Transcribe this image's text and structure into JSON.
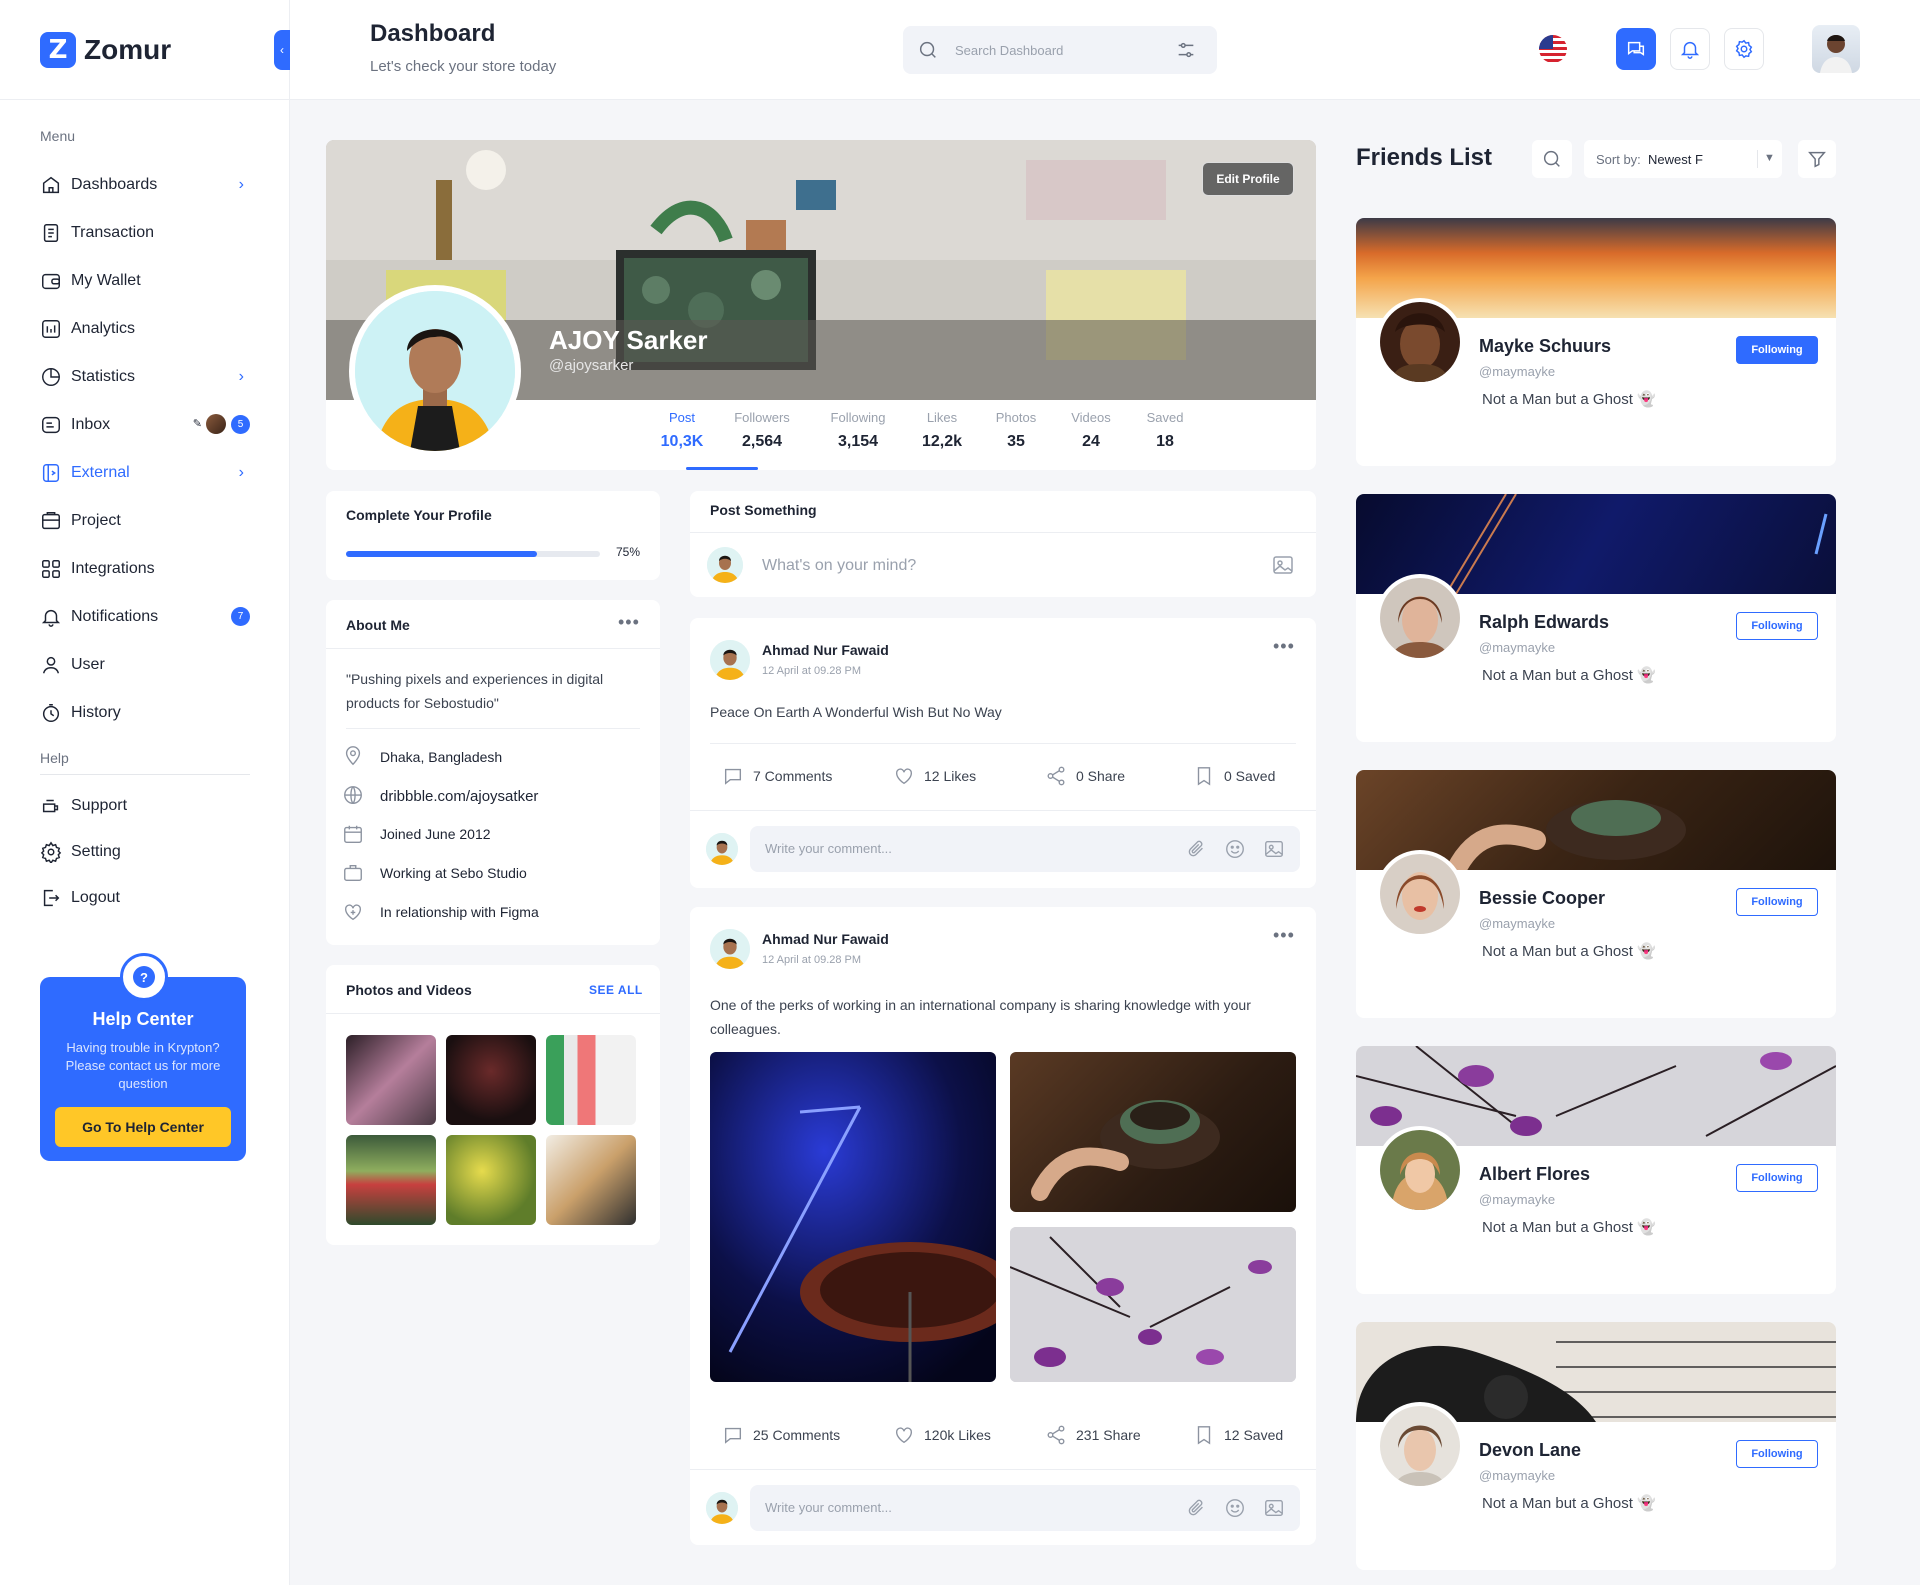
{
  "app": {
    "name": "Zomur"
  },
  "sidebar": {
    "menu_label": "Menu",
    "help_label": "Help",
    "items": [
      {
        "label": "Dashboards",
        "icon": "home-icon",
        "chevron": true
      },
      {
        "label": "Transaction",
        "icon": "receipt-icon"
      },
      {
        "label": "My Wallet",
        "icon": "wallet-icon"
      },
      {
        "label": "Analytics",
        "icon": "analytics-icon"
      },
      {
        "label": "Statistics",
        "icon": "pie-chart-icon",
        "chevron": true
      },
      {
        "label": "Inbox",
        "icon": "inbox-icon",
        "badge": "5"
      },
      {
        "label": "External",
        "icon": "external-icon",
        "chevron": true,
        "active": true
      },
      {
        "label": "Project",
        "icon": "project-icon"
      },
      {
        "label": "Integrations",
        "icon": "integrations-icon"
      },
      {
        "label": "Notifications",
        "icon": "bell-icon",
        "badge": "7"
      },
      {
        "label": "User",
        "icon": "user-icon"
      },
      {
        "label": "History",
        "icon": "history-icon"
      }
    ],
    "help_items": [
      {
        "label": "Support",
        "icon": "support-icon"
      },
      {
        "label": "Setting",
        "icon": "gear-icon"
      },
      {
        "label": "Logout",
        "icon": "logout-icon"
      }
    ],
    "help_card": {
      "title": "Help Center",
      "text": "Having trouble in Krypton? Please contact us for more question",
      "button": "Go To Help Center"
    }
  },
  "header": {
    "title": "Dashboard",
    "subtitle": "Let's check your store today",
    "search_placeholder": "Search Dashboard"
  },
  "profile": {
    "name": "AJOY Sarker",
    "handle": "@ajoysarker",
    "edit_label": "Edit Profile",
    "stats": [
      {
        "label": "Post",
        "value": "10,3K",
        "active": true
      },
      {
        "label": "Followers",
        "value": "2,564"
      },
      {
        "label": "Following",
        "value": "3,154"
      },
      {
        "label": "Likes",
        "value": "12,2k"
      },
      {
        "label": "Photos",
        "value": "35"
      },
      {
        "label": "Videos",
        "value": "24"
      },
      {
        "label": "Saved",
        "value": "18"
      }
    ]
  },
  "complete_profile": {
    "title": "Complete Your Profile",
    "percent_label": "75%",
    "progress": 0.75
  },
  "about": {
    "title": "About Me",
    "quote": "\"Pushing pixels and experiences in digital products for Sebostudio\"",
    "location": "Dhaka, Bangladesh",
    "website": "dribbble.com/ajoysatker",
    "joined": "Joined June 2012",
    "work": "Working at Sebo Studio",
    "relationship": "In relationship with Figma"
  },
  "media": {
    "title": "Photos and Videos",
    "see_all": "SEE ALL"
  },
  "composer": {
    "title": "Post Something",
    "placeholder": "What's on your mind?"
  },
  "posts": [
    {
      "author": "Ahmad Nur Fawaid",
      "time": "12 April at 09.28 PM",
      "text": "Peace On Earth A Wonderful Wish But No Way",
      "comments": "7 Comments",
      "likes": "12 Likes",
      "share": "0 Share",
      "saved": "0 Saved",
      "comment_placeholder": "Write your comment..."
    },
    {
      "author": "Ahmad Nur Fawaid",
      "time": "12 April at 09.28 PM",
      "text": "One of the perks of working in an international company is sharing knowledge with your colleagues.",
      "comments": "25 Comments",
      "likes": "120k Likes",
      "share": "231 Share",
      "saved": "12 Saved",
      "comment_placeholder": "Write your comment..."
    }
  ],
  "friends": {
    "title": "Friends List",
    "sort_label": "Sort by:",
    "sort_value": "Newest F",
    "list": [
      {
        "name": "Mayke Schuurs",
        "handle": "@maymayke",
        "bio": "Not a Man but a Ghost 👻",
        "follow": "Following",
        "solid": true
      },
      {
        "name": "Ralph Edwards",
        "handle": "@maymayke",
        "bio": "Not a Man but a Ghost 👻",
        "follow": "Following"
      },
      {
        "name": "Bessie Cooper",
        "handle": "@maymayke",
        "bio": "Not a Man but a Ghost 👻",
        "follow": "Following"
      },
      {
        "name": "Albert Flores",
        "handle": "@maymayke",
        "bio": "Not a Man but a Ghost 👻",
        "follow": "Following"
      },
      {
        "name": "Devon Lane",
        "handle": "@maymayke",
        "bio": "Not a Man but a Ghost 👻",
        "follow": "Following"
      }
    ]
  },
  "colors": {
    "accent": "#2f6bff",
    "help_button": "#ffc727",
    "background": "#f5f6f9"
  }
}
